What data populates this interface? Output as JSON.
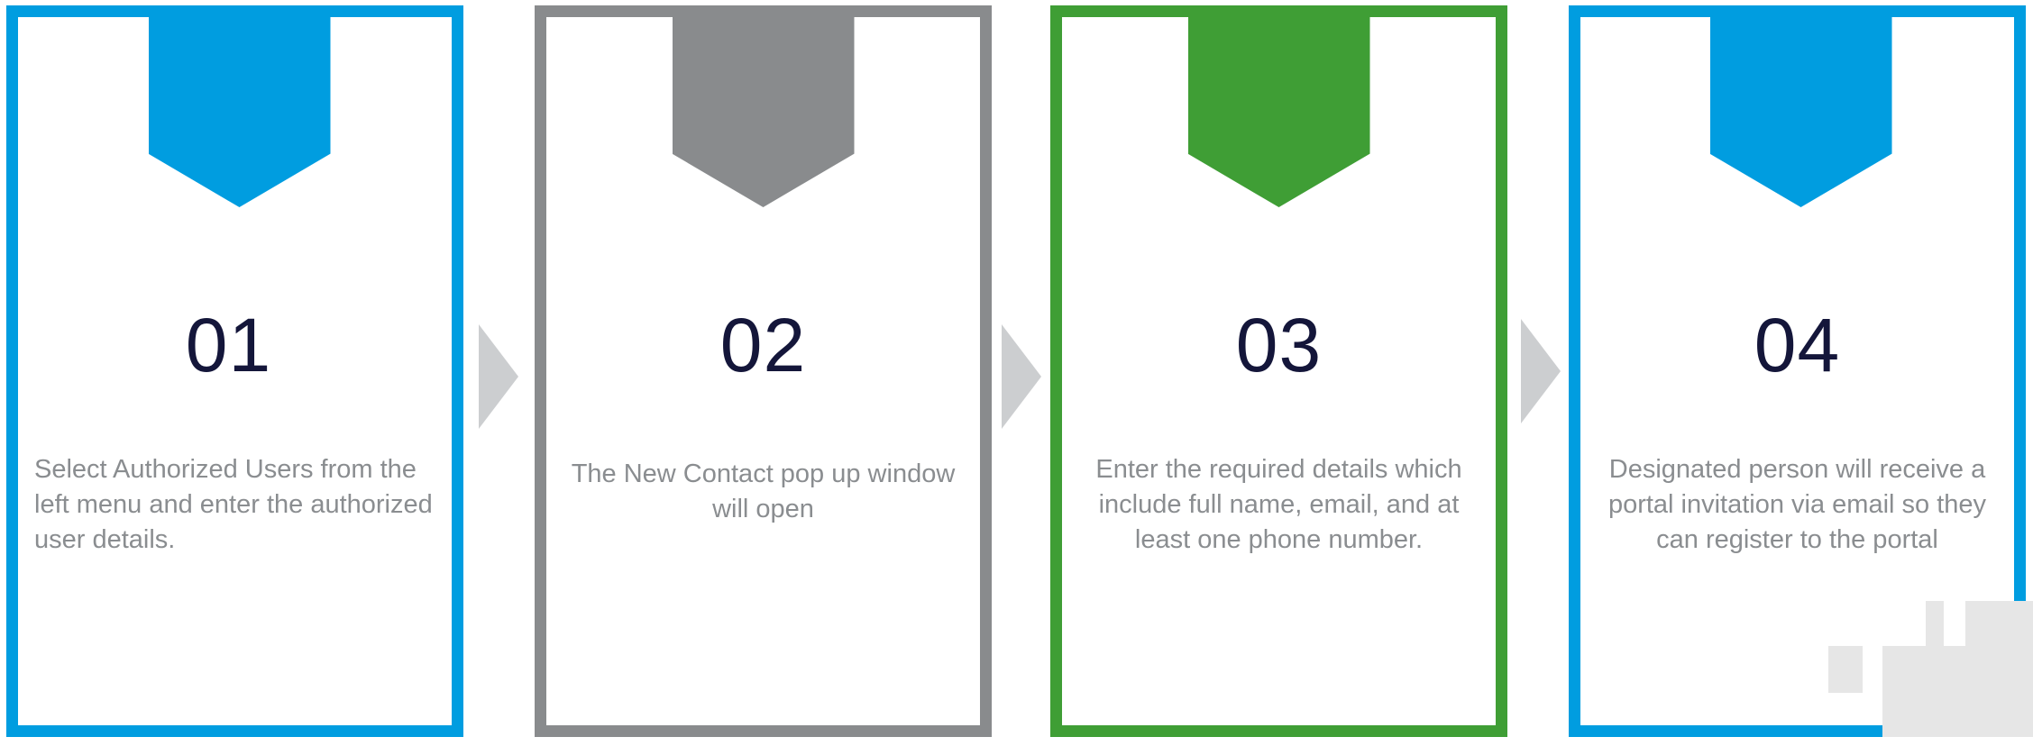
{
  "steps": [
    {
      "number": "01",
      "description": "Select Authorized Users from the left menu and enter the authorized user details.",
      "color": "#009de0"
    },
    {
      "number": "02",
      "description": "The New Contact pop up window will open",
      "color": "#898b8d"
    },
    {
      "number": "03",
      "description": "Enter the required details which include full name, email, and at least one phone number.",
      "color": "#3f9e35"
    },
    {
      "number": "04",
      "description": "Designated person will receive a portal invitation via email so they can register to the portal",
      "color": "#009de0"
    }
  ],
  "connector_color": "#ccced0",
  "number_color": "#14163a",
  "text_color": "#8a8d90"
}
